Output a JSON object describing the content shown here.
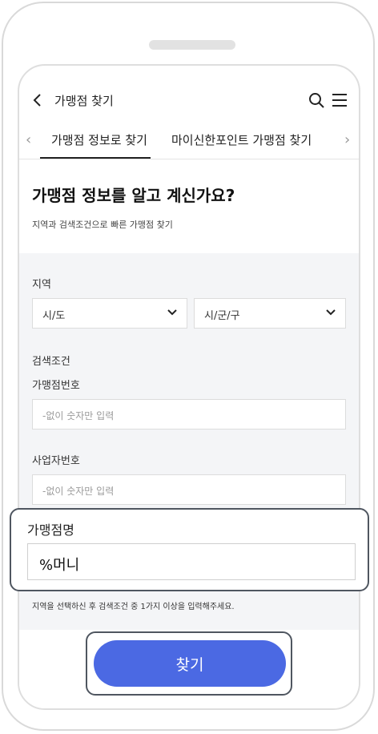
{
  "header": {
    "title": "가맹점 찾기"
  },
  "tabs": [
    {
      "label": "가맹점 정보로 찾기",
      "active": true
    },
    {
      "label": "마이신한포인트 가맹점 찾기",
      "active": false
    }
  ],
  "tab_arrows": {
    "left": "‹",
    "right": "›"
  },
  "main": {
    "title": "가맹점 정보를 알고 계신가요?",
    "subtitle": "지역과 검색조건으로 빠른 가맹점 찾기"
  },
  "form": {
    "region_label": "지역",
    "city_select": "시/도",
    "district_select": "시/군/구",
    "search_conditions_label": "검색조건",
    "merchant_number_label": "가맹점번호",
    "merchant_number_placeholder": "-없이 숫자만 입력",
    "business_number_label": "사업자번호",
    "business_number_placeholder": "-없이 숫자만 입력",
    "merchant_name_label": "가맹점명",
    "merchant_name_value": "%머니",
    "note": "지역을 선택하신 후 검색조건 중 1가지 이상을 입력해주세요."
  },
  "find_button": {
    "label": "찾기"
  },
  "colors": {
    "accent": "#4b69e3",
    "frame": "#4f5660",
    "panel": "#f4f5f7"
  }
}
